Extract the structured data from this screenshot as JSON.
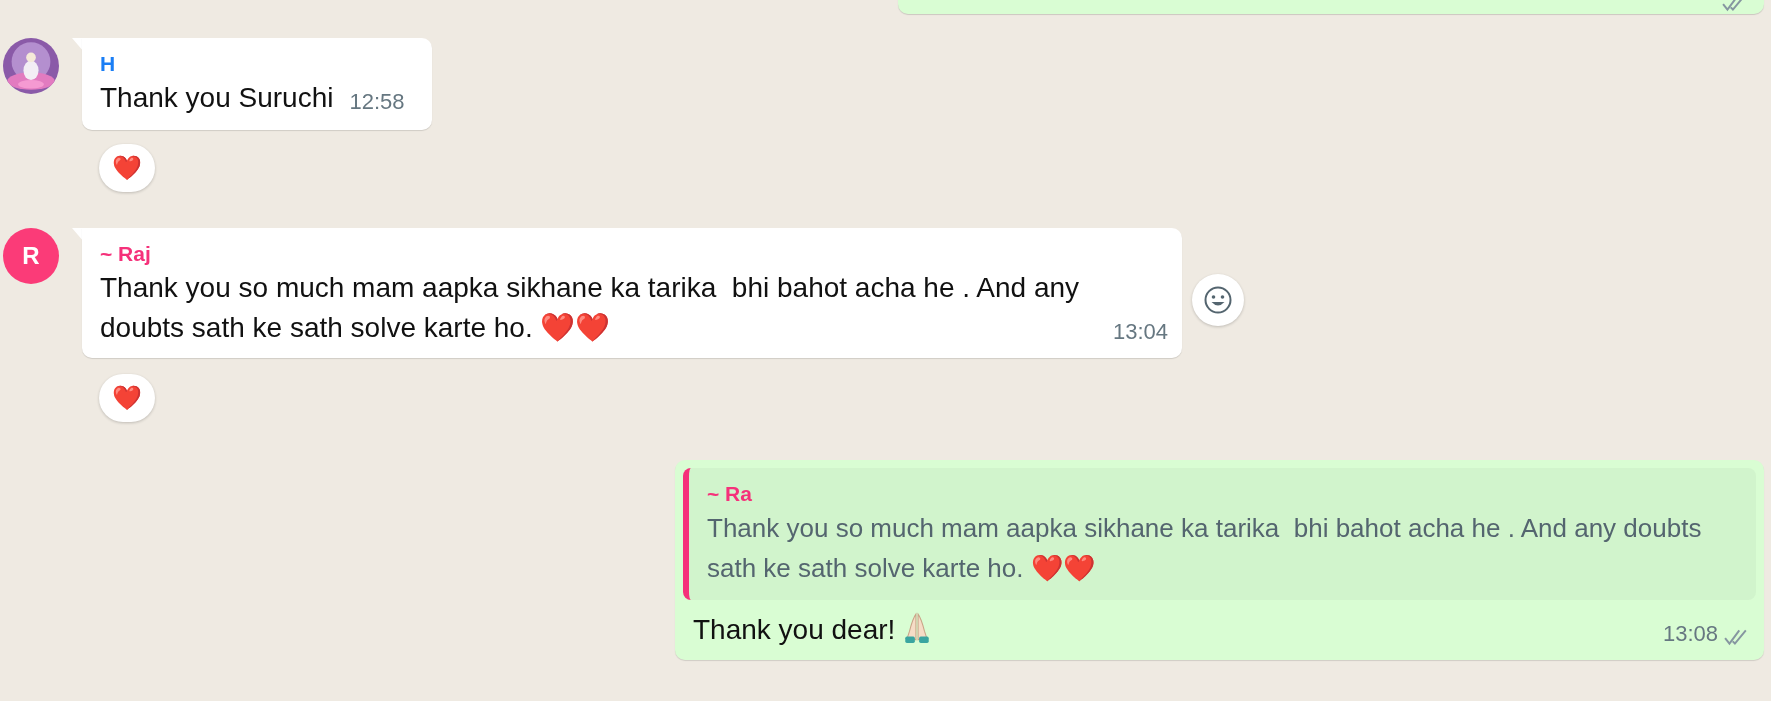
{
  "previous_message_cut": {
    "kind": "outgoing",
    "read": false
  },
  "messages": [
    {
      "kind": "incoming",
      "sender": {
        "name": "H",
        "color": "#1a7ef5"
      },
      "text": "Thank you Suruchi",
      "time": "12:58",
      "reactions": [
        "❤️"
      ]
    },
    {
      "kind": "incoming",
      "avatar": {
        "kind": "letter",
        "letter": "R",
        "color": "#fb3b78"
      },
      "sender": {
        "name": "~ Raj",
        "color": "#f5317a"
      },
      "text": "Thank you so much mam aapka sikhane ka tarika  bhi bahot acha he . And any doubts sath ke sath solve karte ho. ❤️❤️",
      "time": "13:04",
      "reactions": [
        "❤️"
      ],
      "hovered": true
    },
    {
      "kind": "outgoing",
      "quote": {
        "sender": {
          "name": "~ Ra",
          "color": "#f5317a"
        },
        "text": "Thank you so much mam aapka sikhane ka tarika  bhi bahot acha he . And any doubts sath ke sath solve karte ho. ❤️❤️"
      },
      "text": "Thank you dear!",
      "time": "13:08",
      "read": false
    }
  ]
}
